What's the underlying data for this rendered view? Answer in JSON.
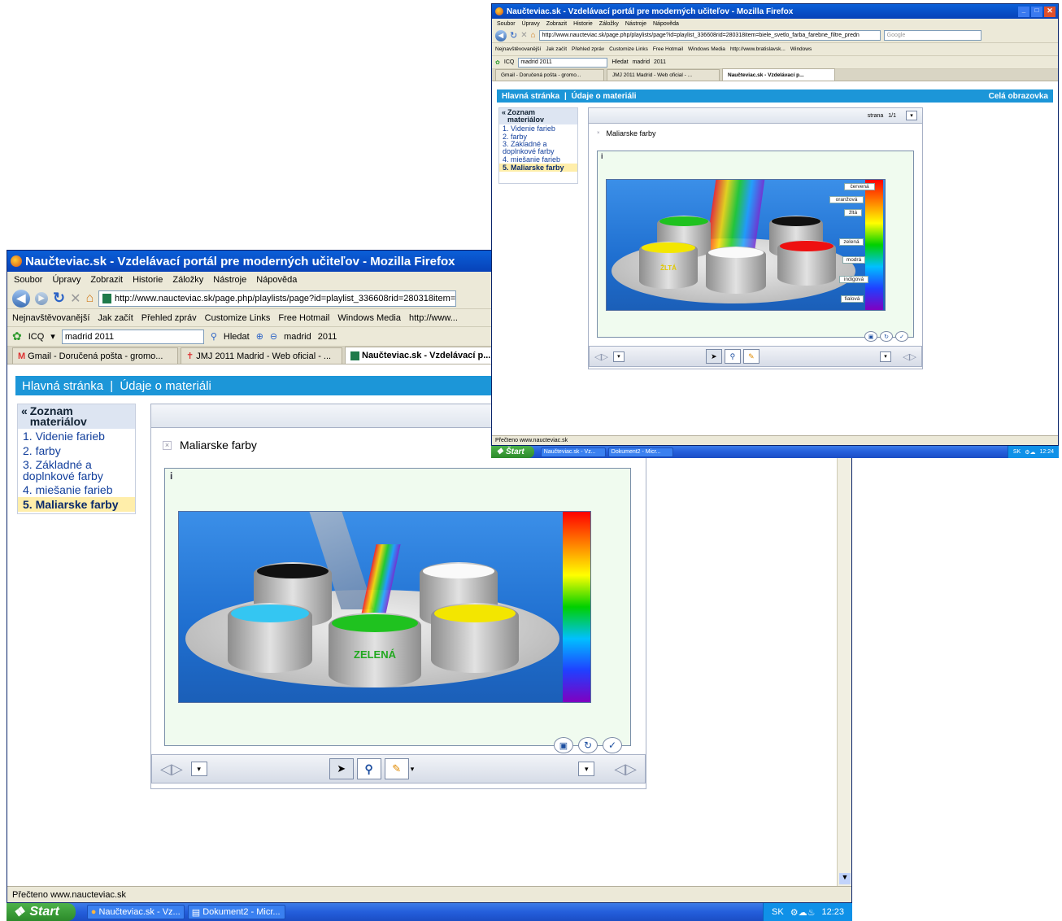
{
  "browser": {
    "title": "Naučteviac.sk - Vzdelávací portál pre moderných učiteľov - Mozilla Firefox",
    "menu": [
      "Soubor",
      "Úpravy",
      "Zobrazit",
      "Historie",
      "Záložky",
      "Nástroje",
      "Nápověda"
    ],
    "url": "http://www.naucteviac.sk/page.php/playlists/page?id=playlist_336608rid=280318item=",
    "url_back": "http://www.naucteviac.sk/page.php/playlists/page?id=playlist_336608rid=280318item=biele_svetlo_farba_farebne_filtre_predn",
    "search_placeholder": "Google",
    "bookmarks": [
      "Nejnavštěvovanější",
      "Jak začít",
      "Přehled zpráv",
      "Customize Links",
      "Free Hotmail",
      "Windows Media",
      "http://www..."
    ],
    "bookmarks_back": [
      "Nejnavštěvovanější",
      "Jak začít",
      "Přehled zpráv",
      "Customize Links",
      "Free Hotmail",
      "Windows Media",
      "http://www.bratislavsk...",
      "Windows"
    ],
    "icq_label": "ICQ",
    "icq_search": "madrid 2011",
    "hledat": "Hledat",
    "madrid_link": "madrid",
    "year_link": "2011",
    "tabs": [
      "Gmail - Doručená pošta - gromo...",
      "JMJ 2011 Madrid - Web oficial - ...",
      "Naučteviac.sk - Vzdelávací p..."
    ],
    "status": "Přečteno www.naucteviac.sk"
  },
  "site": {
    "nav_home": "Hlavná stránka",
    "nav_sep": "|",
    "nav_material": "Údaje o materiáli",
    "fullscreen": "Celá obrazovka",
    "sidebar_heading": "Zoznam materiálov",
    "sidebar_items": [
      "1. Videnie farieb",
      "2. farby",
      "3. Základné a doplnkové farby",
      "4. miešanie farieb",
      "5. Maliarske farby"
    ],
    "page_label": "strana",
    "page_value": "1/1",
    "material_title": "Maliarske farby",
    "info_icon_text": "i",
    "front_can_label": "ZELENÁ",
    "back_can_label": "ŽLTÁ",
    "color_labels": [
      "červená",
      "oranžová",
      "žltá",
      "zelená",
      "modrá",
      "indigová",
      "fialová"
    ]
  },
  "taskbar": {
    "start": "Štart",
    "start_front": "Start",
    "items": [
      "Naučteviac.sk - Vz...",
      "Dokument2 - Micr..."
    ],
    "lang": "SK",
    "time_front": "12:23",
    "time_back": "12:24"
  },
  "colors": {
    "title_blue": "#0a5fd8",
    "site_bar": "#1c96d8",
    "selected_item": "#ffeeaa",
    "taskbar_blue": "#245edb"
  }
}
